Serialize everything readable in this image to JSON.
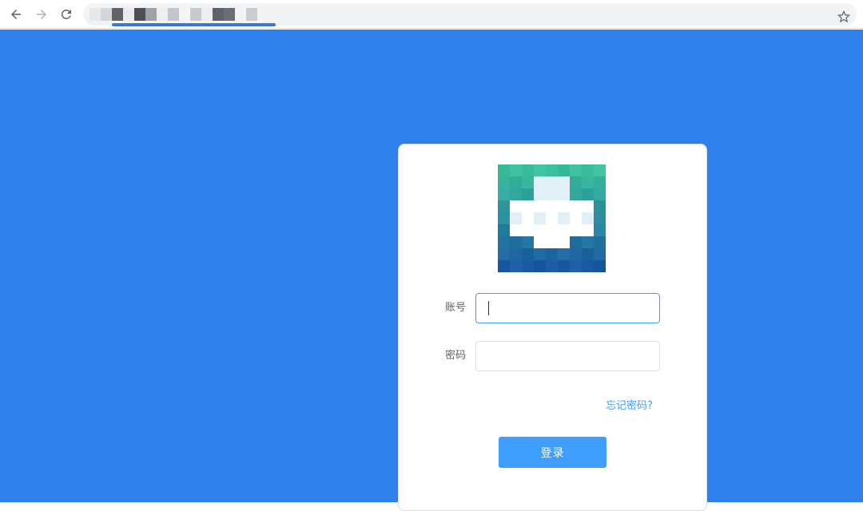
{
  "browser": {
    "back_icon": "arrow-left-icon",
    "forward_icon": "arrow-right-icon",
    "reload_icon": "reload-icon",
    "bookmark_icon": "star-icon"
  },
  "colors": {
    "page_background": "#2f80ed",
    "primary": "#409eff",
    "logo_top": "#3bbf9c",
    "logo_bottom": "#1a5aa0"
  },
  "login": {
    "logo_icon": "pixelated-logo",
    "account_label": "账号",
    "account_value": "",
    "password_label": "密码",
    "password_value": "",
    "forgot_link": "忘记密码?",
    "submit_label": "登录"
  }
}
